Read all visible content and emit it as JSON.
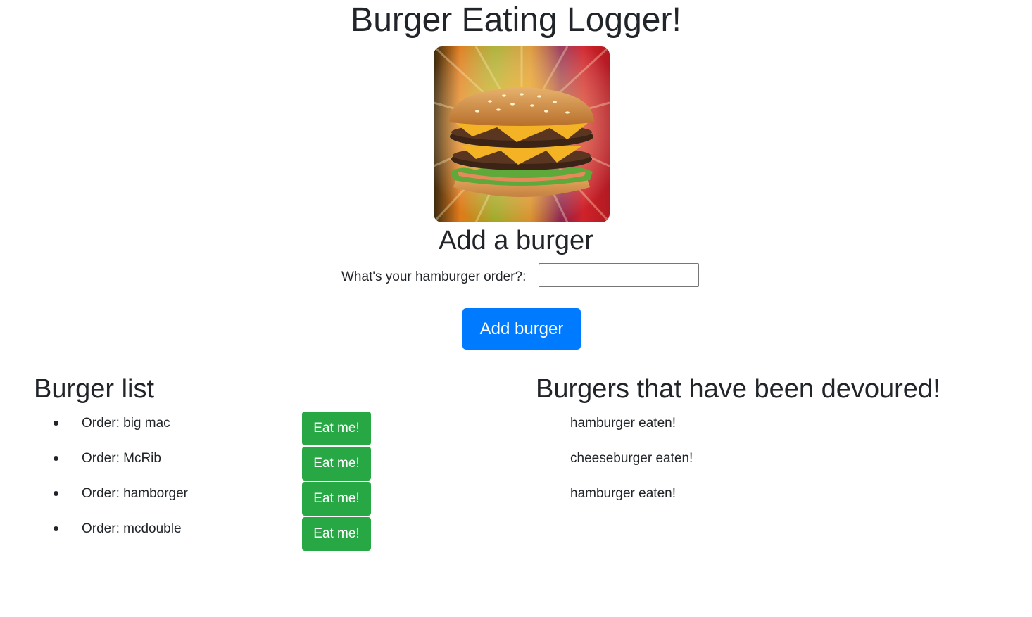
{
  "page": {
    "title": "Burger Eating Logger!"
  },
  "add_form": {
    "heading": "Add a burger",
    "order_label": "What's your hamburger order?:",
    "order_value": "",
    "order_placeholder": "",
    "submit_label": "Add burger"
  },
  "burger_list": {
    "heading": "Burger list",
    "eat_label": "Eat me!",
    "items": [
      {
        "label": "Order: big mac"
      },
      {
        "label": "Order: McRib"
      },
      {
        "label": "Order: hamborger"
      },
      {
        "label": "Order: mcdouble"
      }
    ]
  },
  "devoured": {
    "heading": "Burgers that have been devoured!",
    "items": [
      {
        "label": "hamburger eaten!"
      },
      {
        "label": "cheeseburger eaten!"
      },
      {
        "label": "hamburger eaten!"
      }
    ]
  },
  "colors": {
    "primary_button": "#007bff",
    "eat_button": "#28a745",
    "text": "#212529"
  },
  "icons": {
    "hero_image": "double-cheeseburger-image"
  }
}
